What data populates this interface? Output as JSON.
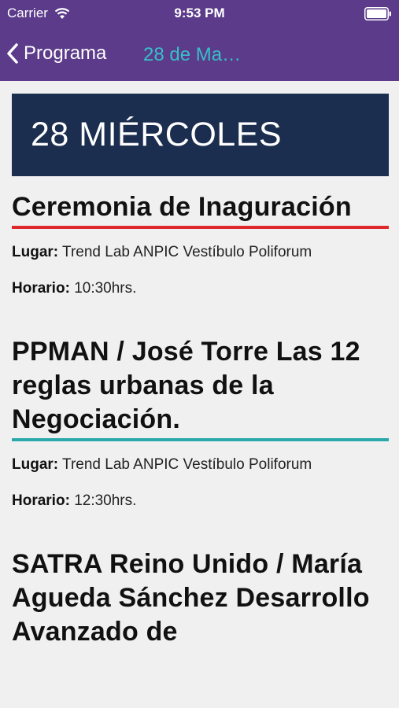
{
  "status_bar": {
    "carrier": "Carrier",
    "time": "9:53 PM"
  },
  "nav": {
    "back_label": "Programa",
    "title": "28 de Ma…"
  },
  "day_header": "28 MIÉRCOLES",
  "labels": {
    "place": "Lugar:",
    "time": "Horario:"
  },
  "events": [
    {
      "title": "Ceremonia de Inaguración",
      "place": "Trend Lab ANPIC Vestíbulo Poliforum",
      "time": "10:30hrs.",
      "accent_color": "#e0282c"
    },
    {
      "title": "PPMAN / José Torre Las 12 reglas urbanas de la Negociación.",
      "place": "Trend Lab ANPIC Vestíbulo Poliforum",
      "time": "12:30hrs.",
      "accent_color": "#2aa9ac"
    },
    {
      "title": "SATRA Reino Unido / María Agueda Sánchez Desarrollo Avanzado de"
    }
  ],
  "colors": {
    "nav_background": "#5b3b8a",
    "nav_title": "#37c0c8",
    "day_header_background": "#1b2e4f",
    "page_background": "#f0f0f1"
  }
}
